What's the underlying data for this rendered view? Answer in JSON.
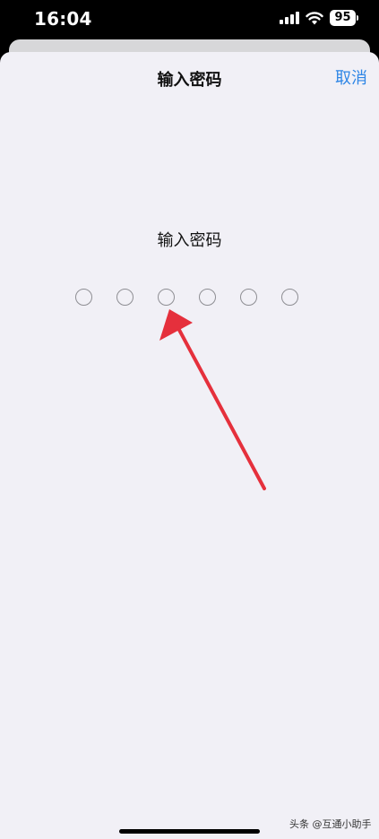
{
  "status_bar": {
    "time": "16:04",
    "battery": "95",
    "icons": [
      "signal-icon",
      "wifi-icon",
      "battery-icon"
    ]
  },
  "nav": {
    "title": "输入密码",
    "cancel_label": "取消"
  },
  "main": {
    "prompt": "输入密码",
    "passcode_length": 6,
    "filled": 0
  },
  "annotation": {
    "arrow_color": "#e5303c"
  },
  "watermark": "头条 @互通小助手",
  "colors": {
    "accent": "#2e86e6",
    "sheet_bg": "#f1f0f6"
  }
}
